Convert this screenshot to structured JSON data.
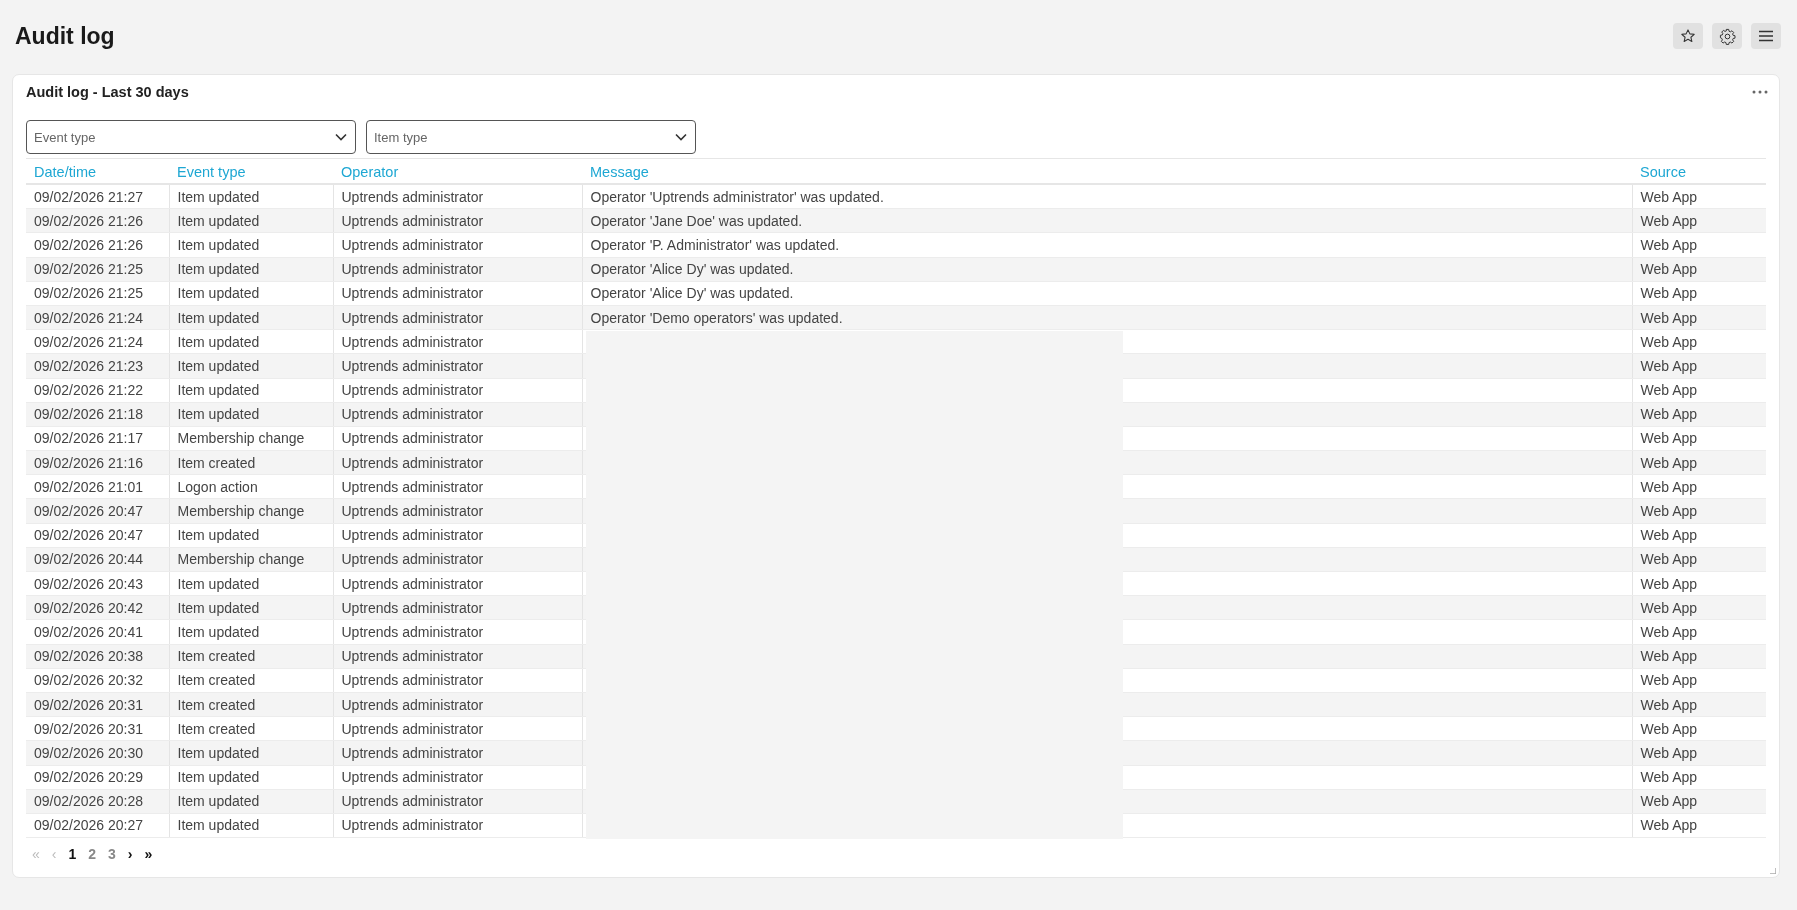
{
  "page_title": "Audit log",
  "toolbar": [
    {
      "kind": "star"
    },
    {
      "kind": "gear"
    },
    {
      "kind": "menu"
    }
  ],
  "card": {
    "title": "Audit log - Last 30 days",
    "filters": [
      {
        "placeholder": "Event type"
      },
      {
        "placeholder": "Item type"
      }
    ],
    "table": {
      "columns": [
        "Date/time",
        "Event type",
        "Operator",
        "Message",
        "Source"
      ],
      "rows": [
        {
          "datetime": "09/02/2026 21:27",
          "event_type": "Item updated",
          "operator": "Uptrends administrator",
          "message": "Operator 'Uptrends administrator' was updated.",
          "source": "Web App"
        },
        {
          "datetime": "09/02/2026 21:26",
          "event_type": "Item updated",
          "operator": "Uptrends administrator",
          "message": "Operator 'Jane Doe' was updated.",
          "source": "Web App"
        },
        {
          "datetime": "09/02/2026 21:26",
          "event_type": "Item updated",
          "operator": "Uptrends administrator",
          "message": "Operator 'P. Administrator' was updated.",
          "source": "Web App"
        },
        {
          "datetime": "09/02/2026 21:25",
          "event_type": "Item updated",
          "operator": "Uptrends administrator",
          "message": "Operator 'Alice Dy' was updated.",
          "source": "Web App"
        },
        {
          "datetime": "09/02/2026 21:25",
          "event_type": "Item updated",
          "operator": "Uptrends administrator",
          "message": "Operator 'Alice Dy' was updated.",
          "source": "Web App"
        },
        {
          "datetime": "09/02/2026 21:24",
          "event_type": "Item updated",
          "operator": "Uptrends administrator",
          "message": "Operator 'Demo operators' was updated.",
          "source": "Web App"
        },
        {
          "datetime": "09/02/2026 21:24",
          "event_type": "Item updated",
          "operator": "Uptrends administrator",
          "source": "Web App"
        },
        {
          "datetime": "09/02/2026 21:23",
          "event_type": "Item updated",
          "operator": "Uptrends administrator",
          "source": "Web App"
        },
        {
          "datetime": "09/02/2026 21:22",
          "event_type": "Item updated",
          "operator": "Uptrends administrator",
          "source": "Web App"
        },
        {
          "datetime": "09/02/2026 21:18",
          "event_type": "Item updated",
          "operator": "Uptrends administrator",
          "source": "Web App"
        },
        {
          "datetime": "09/02/2026 21:17",
          "event_type": "Membership change",
          "operator": "Uptrends administrator",
          "source": "Web App"
        },
        {
          "datetime": "09/02/2026 21:16",
          "event_type": "Item created",
          "operator": "Uptrends administrator",
          "source": "Web App"
        },
        {
          "datetime": "09/02/2026 21:01",
          "event_type": "Logon action",
          "operator": "Uptrends administrator",
          "source": "Web App"
        },
        {
          "datetime": "09/02/2026 20:47",
          "event_type": "Membership change",
          "operator": "Uptrends administrator",
          "source": "Web App"
        },
        {
          "datetime": "09/02/2026 20:47",
          "event_type": "Item updated",
          "operator": "Uptrends administrator",
          "source": "Web App"
        },
        {
          "datetime": "09/02/2026 20:44",
          "event_type": "Membership change",
          "operator": "Uptrends administrator",
          "source": "Web App"
        },
        {
          "datetime": "09/02/2026 20:43",
          "event_type": "Item updated",
          "operator": "Uptrends administrator",
          "source": "Web App"
        },
        {
          "datetime": "09/02/2026 20:42",
          "event_type": "Item updated",
          "operator": "Uptrends administrator",
          "source": "Web App"
        },
        {
          "datetime": "09/02/2026 20:41",
          "event_type": "Item updated",
          "operator": "Uptrends administrator",
          "source": "Web App"
        },
        {
          "datetime": "09/02/2026 20:38",
          "event_type": "Item created",
          "operator": "Uptrends administrator",
          "source": "Web App"
        },
        {
          "datetime": "09/02/2026 20:32",
          "event_type": "Item created",
          "operator": "Uptrends administrator",
          "source": "Web App"
        },
        {
          "datetime": "09/02/2026 20:31",
          "event_type": "Item created",
          "operator": "Uptrends administrator",
          "source": "Web App"
        },
        {
          "datetime": "09/02/2026 20:31",
          "event_type": "Item created",
          "operator": "Uptrends administrator",
          "source": "Web App"
        },
        {
          "datetime": "09/02/2026 20:30",
          "event_type": "Item updated",
          "operator": "Uptrends administrator",
          "source": "Web App"
        },
        {
          "datetime": "09/02/2026 20:29",
          "event_type": "Item updated",
          "operator": "Uptrends administrator",
          "source": "Web App"
        },
        {
          "datetime": "09/02/2026 20:28",
          "event_type": "Item updated",
          "operator": "Uptrends administrator",
          "source": "Web App"
        },
        {
          "datetime": "09/02/2026 20:27",
          "event_type": "Item updated",
          "operator": "Uptrends administrator",
          "source": "Web App"
        }
      ]
    },
    "pagination": {
      "first": {
        "label": "«",
        "disabled": true
      },
      "prev": {
        "label": "‹",
        "disabled": true
      },
      "pages": [
        {
          "label": "1",
          "selected": true
        },
        {
          "label": "2",
          "selected": false
        },
        {
          "label": "3",
          "selected": false
        }
      ],
      "next": {
        "label": "›",
        "disabled": false
      },
      "last": {
        "label": "»",
        "disabled": false
      }
    }
  }
}
